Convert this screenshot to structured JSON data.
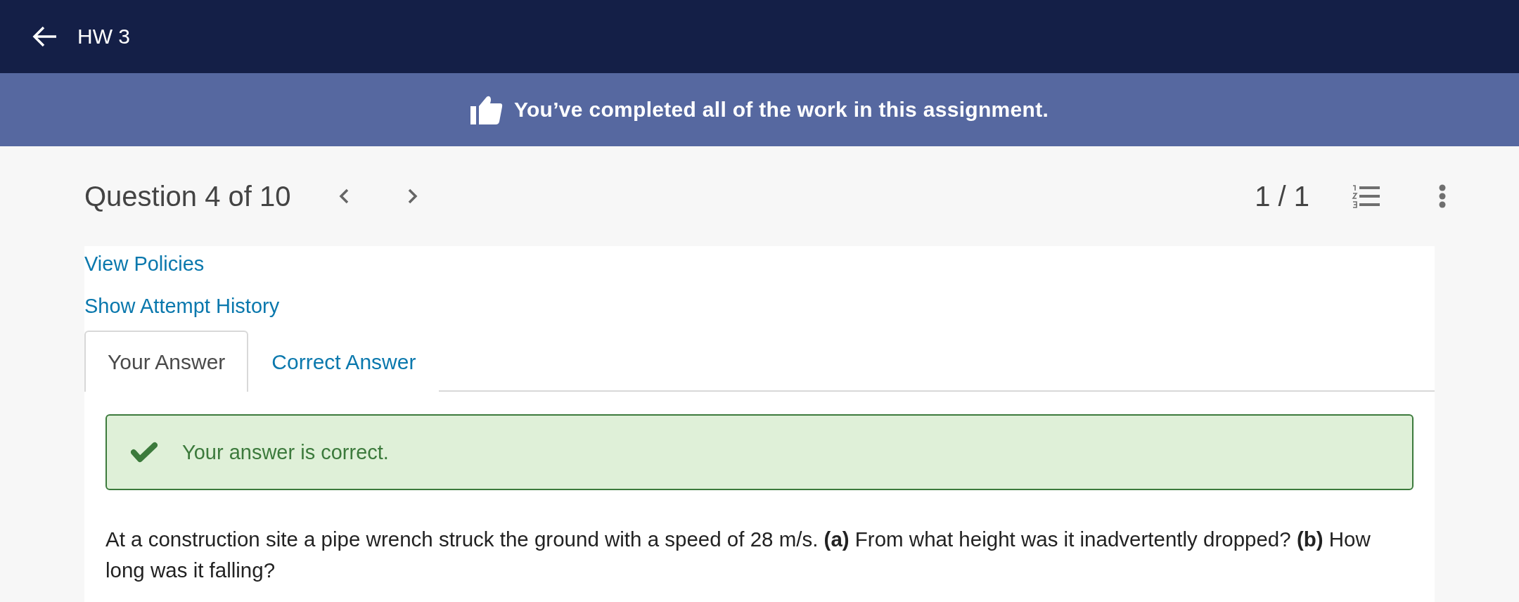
{
  "header": {
    "title": "HW 3"
  },
  "banner": {
    "message": "You’ve completed all of the work in this assignment."
  },
  "question_bar": {
    "title": "Question 4 of 10",
    "attempts": "1 / 1"
  },
  "links": [
    "View Policies",
    "Show Attempt History"
  ],
  "tabs": [
    {
      "label": "Your Answer",
      "selected": true
    },
    {
      "label": "Correct Answer",
      "selected": false
    }
  ],
  "feedback": {
    "kind": "correct",
    "message": "Your answer is correct."
  },
  "question": {
    "text": "At a construction site a pipe wrench struck the ground with a speed of 28 m/s. **(a)** From what height was it inadvertently dropped? **(b)** How long was it falling?"
  }
}
